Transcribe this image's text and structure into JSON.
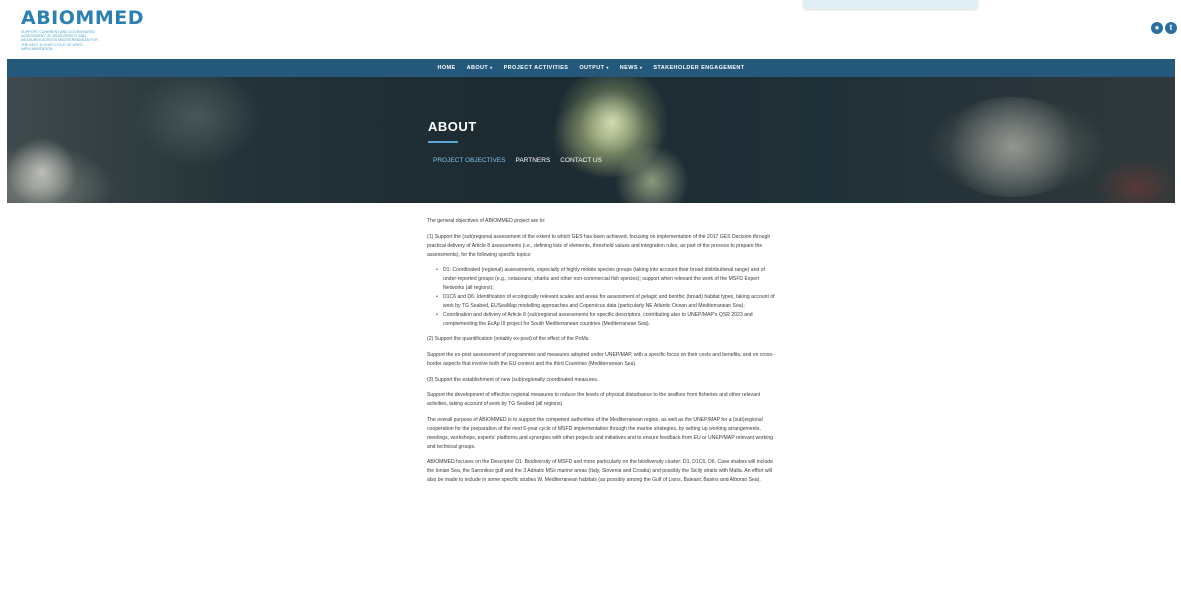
{
  "header": {
    "logo_title": "ABIOMMED",
    "logo_subtitle": "Support coherent and coordinated assessment of biodiversity and measures across Mediterranean for the next 6-year cycle of MSFD implementation",
    "social": [
      {
        "icon": "flickr-icon",
        "glyph": "●"
      },
      {
        "icon": "twitter-icon",
        "glyph": "t"
      }
    ]
  },
  "nav": {
    "items": [
      {
        "label": "HOME",
        "dropdown": false
      },
      {
        "label": "ABOUT",
        "dropdown": true
      },
      {
        "label": "PROJECT ACTIVITIES",
        "dropdown": false
      },
      {
        "label": "OUTPUT",
        "dropdown": true
      },
      {
        "label": "NEWS",
        "dropdown": true
      },
      {
        "label": "STAKEHOLDER ENGAGEMENT",
        "dropdown": false
      }
    ],
    "caret": "▾"
  },
  "hero": {
    "title": "ABOUT",
    "links": [
      {
        "label": "PROJECT OBJECTIVES",
        "active": true
      },
      {
        "label": "PARTNERS",
        "active": false
      },
      {
        "label": "CONTACT US",
        "active": false
      }
    ]
  },
  "content": {
    "intro": "The general objectives of ABIOMMED project are to:",
    "obj1": "(1) Support the (sub)regional assessment of the extent to which GES has been achieved, focusing on implementation of the 2017 GES Decision through practical delivery of Article 8 assessments (i.e., defining lists of elements, threshold values and integration rules, as part of the process to prepare the assessments), for the following specific topics:",
    "bullets": [
      "D1: Coordinated (regional) assessments, especially of highly mobile species groups (taking into account their broad distributional range) and of under-reported groups (e.g., cetaceans, sharks and other non-commercial fish species); support when relevant the work of the MSFD Expert Networks (all regions);",
      "D1C6 and D6: Identification of ecologically relevant scales and areas for assessment of pelagic and benthic (broad) habitat types, taking account of work by TG Seabed, EUSeaMap modelling approaches and Copernicus data (particularly NE Atlantic Ocean and Mediterranean Sea);",
      "Coordination and delivery of Article 8 (sub)regional assessments for specific descriptors, contributing also to UNEP/MAP's QSR 2023 and complementing the EcAp III project for South Mediterranean countries (Mediterranean Sea)."
    ],
    "obj2": "(2) Support the quantification (notably ex-post) of the effect of the PoMs.",
    "obj2_detail": "Support the ex-post assessment of programmes and measures adopted under UNEP/MAP, with a specific focus on their costs and benefits, and on cross-border aspects that involve both the EU context and the third Countries (Mediterranean Sea).",
    "obj3": "(3) Support the establishment of new (sub)regionally coordinated measures.",
    "obj3_detail": "Support the development of effective regional measures to reduce the levels of physical disturbance to the seafloor from fisheries and other relevant activities, taking account of work by TG Seabed (all regions).",
    "purpose": "The overall purpose of ABIOMMED is to support the competent authorities of the Mediterranean region, as well as the UNEP/MAP for a (sub)regional cooperation for the preparation of the next 6-year cycle of MSFD implementation through the marine strategies, by setting up working arrangements, meetings, workshops, experts' platforms and synergies with other projects and initiatives and to ensure feedback from EU or UNEP/MAP relevant working and technical groups.",
    "focus": "ABIOMMED focuses on the Descriptor D1: Biodiversity of MSFD and more particularly on the biodiversity cluster: D1, D1C6, D6. Case studies will include the Ionian Sea, the Saronikos gulf and the 3 Adriatic MSs marine areas (Italy, Slovenia and Croatia) and possibly the Sicily straits with Malta. An effort will also be made to include in some specific studies W. Mediterranean habitats (as possibly among the Gulf of Lions, Balearic Basins and Alboran Sea)."
  }
}
